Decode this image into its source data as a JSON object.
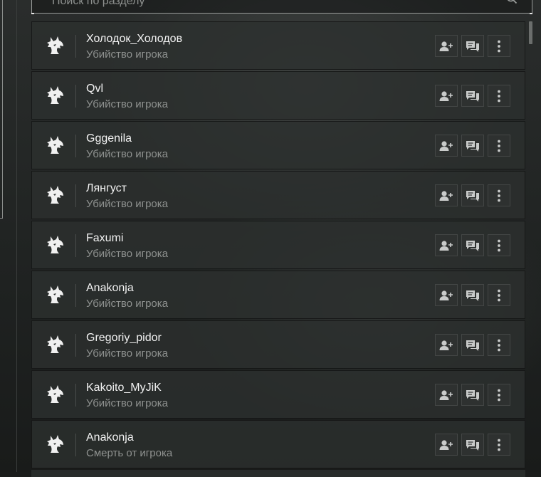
{
  "search": {
    "placeholder": "Поиск по разделу"
  },
  "icons": {
    "search": "search-icon",
    "add_friend": "add-friend-icon",
    "message": "chat-icon",
    "more": "more-vertical-icon",
    "avatar": "wolf-icon"
  },
  "colors": {
    "name": "#f2f2f2",
    "subtitle": "#8f9290",
    "row_bg": "#2c2f2e"
  },
  "events": [
    {
      "name": "Холодок_Холодов",
      "type": "Убийство игрока"
    },
    {
      "name": "Qvl",
      "type": "Убийство игрока"
    },
    {
      "name": "Gggenila",
      "type": "Убийство игрока"
    },
    {
      "name": "Лянгуст",
      "type": "Убийство игрока"
    },
    {
      "name": "Faxumi",
      "type": "Убийство игрока"
    },
    {
      "name": "Anakonja",
      "type": "Убийство игрока"
    },
    {
      "name": "Gregoriy_pidor",
      "type": "Убийство игрока"
    },
    {
      "name": "Kakoito_MyJiK",
      "type": "Убийство игрока"
    },
    {
      "name": "Anakonja",
      "type": "Смерть от игрока"
    }
  ]
}
